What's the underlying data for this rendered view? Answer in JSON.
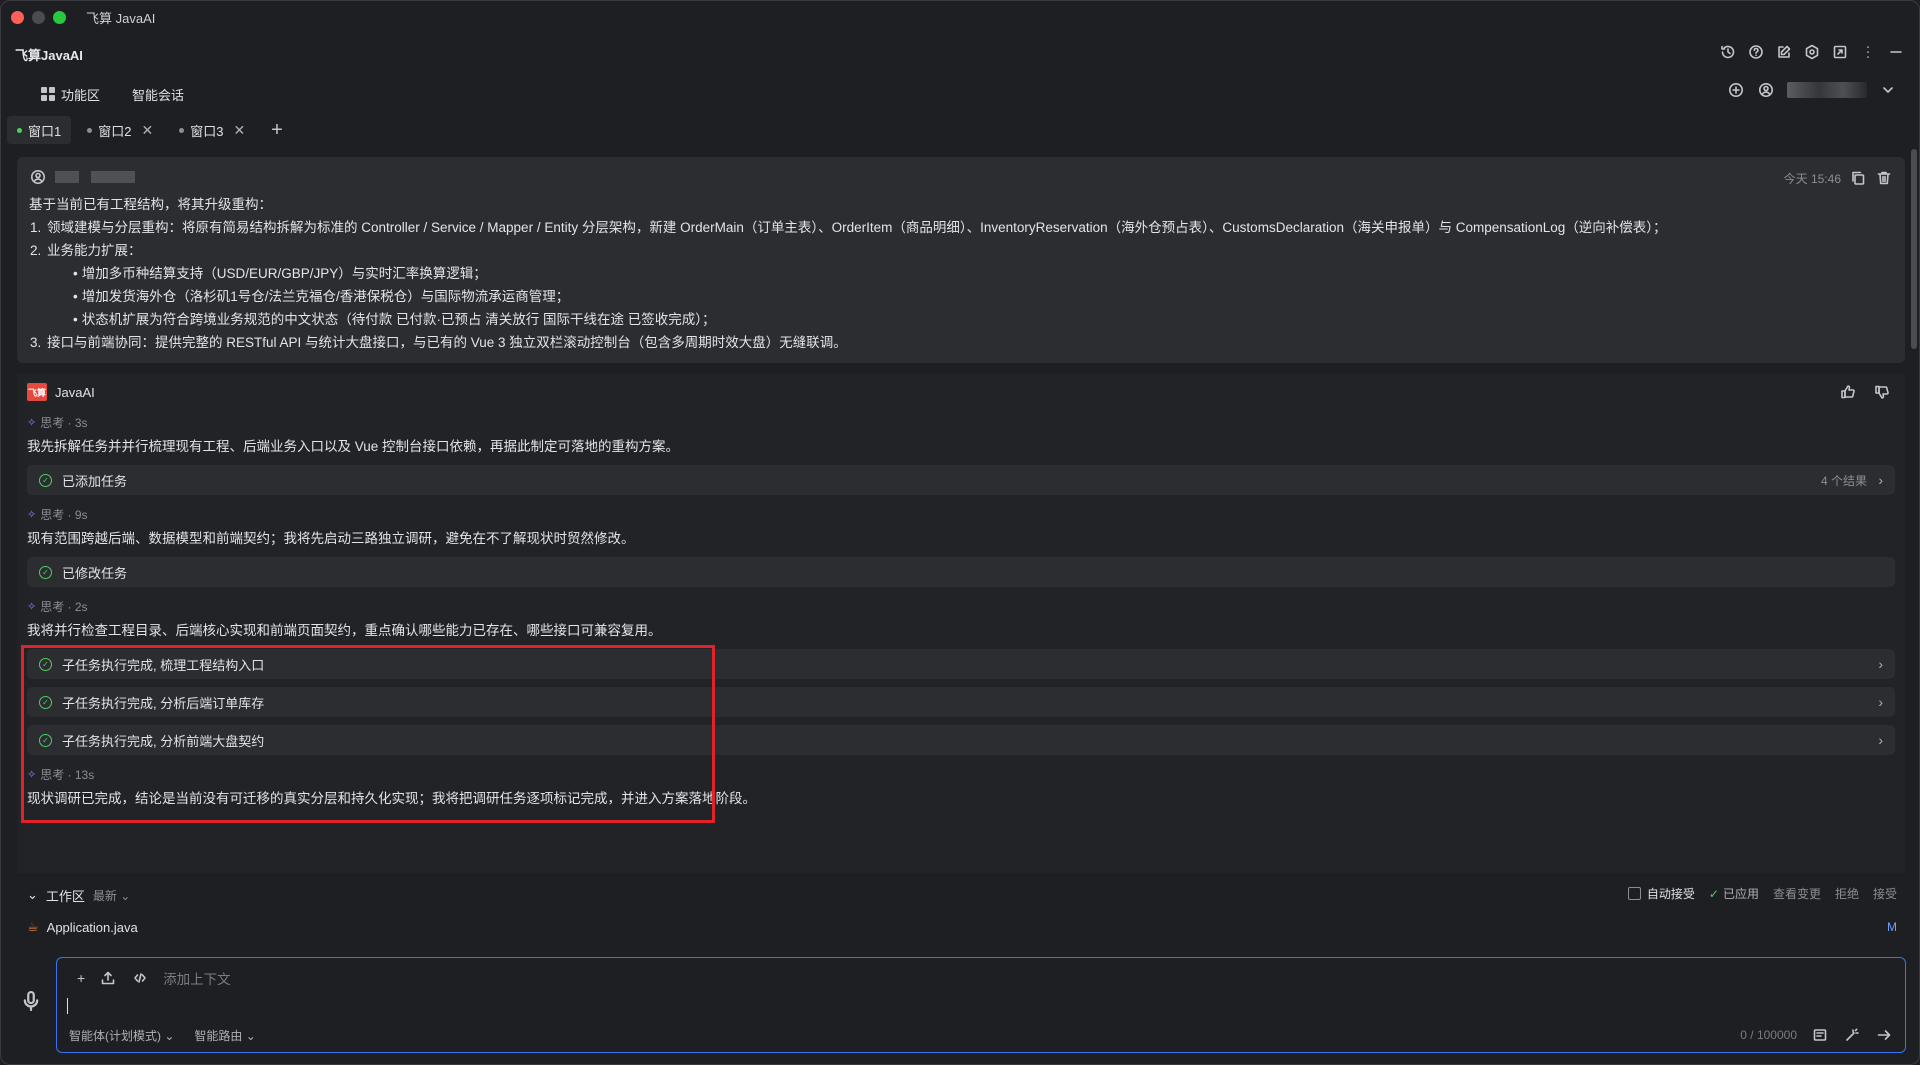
{
  "window": {
    "title": "飞算 JavaAI"
  },
  "header": {
    "app_name": "飞算JavaAI"
  },
  "nav": {
    "function_area": "功能区",
    "smart_chat": "智能会话"
  },
  "tabs": [
    {
      "label": "窗口1",
      "active": true
    },
    {
      "label": "窗口2",
      "active": false
    },
    {
      "label": "窗口3",
      "active": false
    }
  ],
  "user_message": {
    "time": "今天 15:46",
    "intro": "基于当前已有工程结构，将其升级重构：",
    "item1": "领域建模与分层重构：将原有简易结构拆解为标准的 Controller / Service / Mapper / Entity 分层架构，新建 OrderMain（订单主表）、OrderItem（商品明细）、InventoryReservation（海外仓预占表）、CustomsDeclaration（海关申报单）与 CompensationLog（逆向补偿表）；",
    "item2": "业务能力扩展：",
    "sub1": "增加多币种结算支持（USD/EUR/GBP/JPY）与实时汇率换算逻辑；",
    "sub2": "增加发货海外仓（洛杉矶1号仓/法兰克福仓/香港保税仓）与国际物流承运商管理；",
    "sub3": "状态机扩展为符合跨境业务规范的中文状态（待付款 已付款·已预占 清关放行 国际干线在途 已签收完成）；",
    "item3": "接口与前端协同：提供完整的 RESTful API 与统计大盘接口，与已有的 Vue 3 独立双栏滚动控制台（包含多周期时效大盘）无缝联调。"
  },
  "assistant": {
    "name": "JavaAI",
    "logo_text": "飞算",
    "think1": "思考 · 3s",
    "text1": "我先拆解任务并并行梳理现有工程、后端业务入口以及 Vue 控制台接口依赖，再据此制定可落地的重构方案。",
    "task1": "已添加任务",
    "task1_count": "4 个结果",
    "think2": "思考 · 9s",
    "text2": "现有范围跨越后端、数据模型和前端契约；我将先启动三路独立调研，避免在不了解现状时贸然修改。",
    "task2": "已修改任务",
    "think3": "思考 · 2s",
    "text3": "我将并行检查工程目录、后端核心实现和前端页面契约，重点确认哪些能力已存在、哪些接口可兼容复用。",
    "sub_task1": "子任务执行完成, 梳理工程结构入口",
    "sub_task2": "子任务执行完成, 分析后端订单库存",
    "sub_task3": "子任务执行完成, 分析前端大盘契约",
    "think4": "思考 · 13s",
    "text4": "现状调研已完成，结论是当前没有可迁移的真实分层和持久化实现；我将把调研任务逐项标记完成，并进入方案落地阶段。"
  },
  "workspace": {
    "label": "工作区",
    "latest": "最新",
    "auto_accept": "自动接受",
    "applied": "已应用",
    "view_changes": "查看变更",
    "reject": "拒绝",
    "accept": "接受",
    "file": "Application.java",
    "file_status": "M"
  },
  "composer": {
    "placeholder": "添加上下文",
    "mode": "智能体(计划模式)",
    "route": "智能路由",
    "counter": "0 / 100000"
  }
}
